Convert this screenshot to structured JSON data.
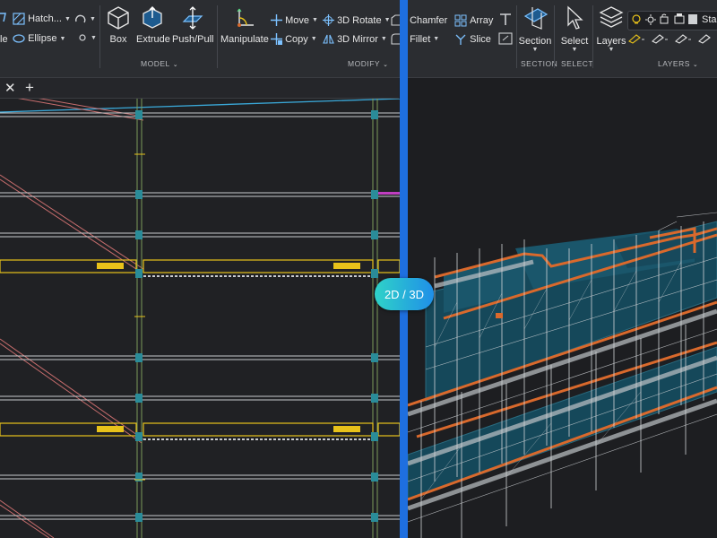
{
  "ribbon": {
    "draw": {
      "hatch": "Hatch...",
      "ellipse": "Ellipse",
      "cut_left": "le"
    },
    "model": {
      "box": "Box",
      "extrude": "Extrude",
      "push_pull": "Push/Pull",
      "label": "MODEL"
    },
    "manipulate": "Manipulate",
    "modify": {
      "move": "Move",
      "copy": "Copy",
      "rotate3d": "3D Rotate",
      "mirror3d": "3D Mirror",
      "chamfer": "Chamfer",
      "fillet": "Fillet",
      "array": "Array",
      "slice": "Slice",
      "label": "MODIFY"
    },
    "section": {
      "button": "Section",
      "label": "SECTION"
    },
    "select": {
      "button": "Select",
      "label": "SELECT"
    },
    "layers": {
      "button": "Layers",
      "label": "LAYERS",
      "current": "Sta"
    }
  },
  "tabs": {
    "close": "✕",
    "add": "+"
  },
  "toggle": "2D / 3D",
  "colors": {
    "ribbon_bg": "#2b2d31",
    "canvas_bg": "#202124",
    "divider": "#1e6fe0",
    "toggle_start": "#2fd3c8",
    "toggle_end": "#1f8fe8",
    "highlight_yellow": "#e8c21a",
    "beam_orange": "#d9692c",
    "model_teal": "#15485a"
  }
}
